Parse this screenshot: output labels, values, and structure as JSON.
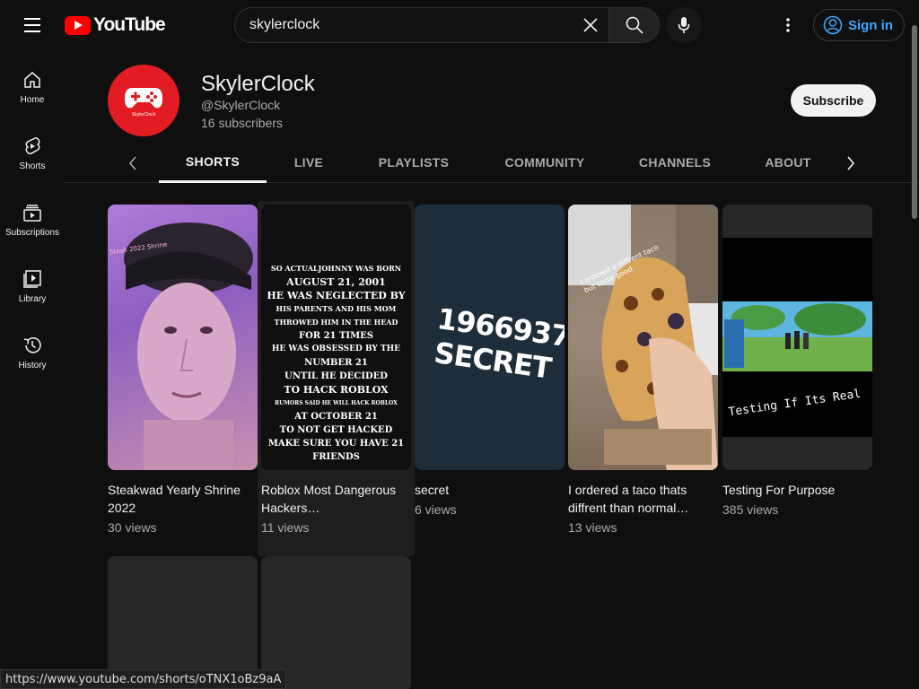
{
  "header": {
    "logo_text": "YouTube",
    "search_value": "skylerclock",
    "signin_label": "Sign in"
  },
  "sidebar": {
    "items": [
      {
        "label": "Home",
        "icon": "home-icon"
      },
      {
        "label": "Shorts",
        "icon": "shorts-icon"
      },
      {
        "label": "Subscriptions",
        "icon": "subscriptions-icon"
      },
      {
        "label": "Library",
        "icon": "library-icon"
      },
      {
        "label": "History",
        "icon": "history-icon"
      }
    ]
  },
  "channel": {
    "name": "SkylerClock",
    "handle": "@SkylerClock",
    "subscribers": "16 subscribers",
    "avatar_text": "SkylerClock",
    "subscribe_label": "Subscribe"
  },
  "tabs": [
    "SHORTS",
    "LIVE",
    "PLAYLISTS",
    "COMMUNITY",
    "CHANNELS",
    "ABOUT"
  ],
  "shorts": [
    {
      "title": "Steakwad Yearly Shrine 2022",
      "views": "30 views",
      "overlay": "Steak 2022 Shrine"
    },
    {
      "title": "Roblox Most Dangerous Hackers…",
      "views": "11 views",
      "overlay": [
        "SO ACTUALJOHNNY WAS BORN",
        "AUGUST 21, 2001",
        "HE WAS NEGLECTED BY",
        "HIS PARENTS AND HIS MOM",
        "THROWED HIM IN THE HEAD",
        "FOR 21 TIMES",
        "HE WAS OBSESSED BY THE",
        "NUMBER 21",
        "UNTIL HE DECIDED",
        "TO HACK ROBLOX",
        "RUMORS SAID HE WILL HACK ROBLOX",
        "AT OCTOBER 21",
        "TO NOT GET HACKED",
        "MAKE SURE YOU HAVE 21",
        "FRIENDS"
      ]
    },
    {
      "title": "secret",
      "views": "6 views",
      "overlay_number": "1966937",
      "overlay_word": "SECRET"
    },
    {
      "title": "I ordered a taco thats diffrent than normal…",
      "views": "13 views",
      "overlay": "I ordered a diffrent taco but taste good"
    },
    {
      "title": "Testing For Purpose",
      "views": "385 views",
      "overlay": "Testing If Its Real"
    }
  ],
  "status_url": "https://www.youtube.com/shorts/oTNX1oBz9aA",
  "colors": {
    "background": "#0f0f0f",
    "logo_red": "#ff0000",
    "avatar_red": "#e31b23",
    "link_blue": "#3ea6ff"
  }
}
